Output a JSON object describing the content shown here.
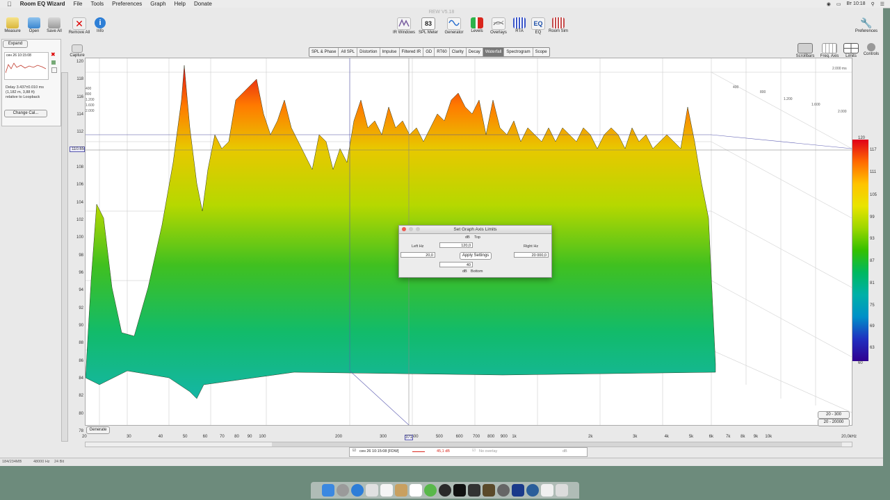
{
  "menubar": {
    "app_name": "Room EQ Wizard",
    "items": [
      "File",
      "Tools",
      "Preferences",
      "Graph",
      "Help",
      "Donate"
    ],
    "clock": "Вт 10:18"
  },
  "window_title": "REW V5.18",
  "toolbar_left": [
    {
      "label": "Measure",
      "icon": "measure-icon"
    },
    {
      "label": "Open",
      "icon": "folder-icon"
    },
    {
      "label": "Save All",
      "icon": "save-icon"
    },
    {
      "label": "Remove All",
      "icon": "remove-icon"
    },
    {
      "label": "Info",
      "icon": "info-icon"
    }
  ],
  "toolbar_center": [
    {
      "label": "IR Windows",
      "icon": "ir-windows-icon"
    },
    {
      "label": "SPL Meter",
      "icon": "spl-meter-icon",
      "readout": "83"
    },
    {
      "label": "Generator",
      "icon": "generator-icon"
    },
    {
      "label": "Levels",
      "icon": "levels-icon"
    },
    {
      "label": "Overlays",
      "icon": "overlays-icon"
    },
    {
      "label": "RTA",
      "icon": "rta-icon"
    },
    {
      "label": "EQ",
      "icon": "eq-icon"
    },
    {
      "label": "Room Sim",
      "icon": "room-sim-icon"
    }
  ],
  "preferences_label": "Preferences",
  "capture_label": "Capture",
  "graph_tabs": [
    "SPL & Phase",
    "All SPL",
    "Distortion",
    "Impulse",
    "Filtered IR",
    "GD",
    "RT60",
    "Clarity",
    "Decay",
    "Waterfall",
    "Spectrogram",
    "Scope"
  ],
  "active_tab": "Waterfall",
  "right_toolbar": [
    {
      "label": "Scrollbars",
      "icon": "scrollbars-icon"
    },
    {
      "label": "Freq. Axis",
      "icon": "freq-axis-icon"
    },
    {
      "label": "Limits",
      "icon": "limits-icon"
    },
    {
      "label": "Controls",
      "icon": "controls-icon"
    }
  ],
  "left_panel": {
    "expand_label": "Expand",
    "measurement_name": "сен 26 10:15:08",
    "delay_text_1": "Delay 3.437±0.010 ms",
    "delay_text_2": "(1,182 m, 3,88 ft)",
    "delay_text_3": "relative to Loopback",
    "change_cal_label": "Change Cal..."
  },
  "y_axis": {
    "ticks": [
      "120",
      "118",
      "116",
      "114",
      "112",
      "110",
      "108",
      "106",
      "104",
      "102",
      "100",
      "98",
      "96",
      "94",
      "92",
      "90",
      "88",
      "86",
      "84",
      "82",
      "80",
      "78"
    ],
    "cursor_value": "110.65"
  },
  "x_axis": {
    "ticks": [
      "20",
      "30",
      "40",
      "50",
      "60",
      "70",
      "80",
      "90",
      "100",
      "200",
      "300",
      "400",
      "500",
      "600",
      "700",
      "800",
      "900",
      "1k",
      "2k",
      "3k",
      "4k",
      "5k",
      "6k",
      "7k",
      "8k",
      "9k",
      "10k",
      "20,0kHz"
    ],
    "cursor_value": "371"
  },
  "time_axis_labels": [
    "2.000 ms",
    "400",
    "800",
    "1.200",
    "1.600",
    "2.000"
  ],
  "left_time_labels": [
    "400",
    "800",
    "1.200",
    "1.600",
    "2.000"
  ],
  "colorbar": {
    "ticks": [
      "120",
      "117",
      "111",
      "105",
      "99",
      "93",
      "87",
      "81",
      "75",
      "69",
      "63",
      "60"
    ]
  },
  "range_buttons": [
    "20 - 300",
    "20 - 20000"
  ],
  "generate_label": "Generate",
  "dialog": {
    "title": "Set Graph Axis Limits",
    "top_unit": "dB",
    "top_label": "Top",
    "top_value": "120,0",
    "left_label": "Left Hz",
    "left_value": "20,0",
    "right_label": "Right Hz",
    "right_value": "20 000,0",
    "apply_label": "Apply Settings",
    "bottom_value": "40",
    "bottom_unit": "dB",
    "bottom_label": "Bottom"
  },
  "legend": {
    "measurement": "сен 26 10:15:08 [FDW]",
    "level": "45,1 dB",
    "overlay": "No overlay",
    "overlay_unit": "dB"
  },
  "status": {
    "memory": "184/234MB",
    "rate": "48000 Hz",
    "bits": "24 Bit"
  },
  "colors": {
    "accent_red": "#d9261c",
    "dialog_bg": "#ececec"
  }
}
